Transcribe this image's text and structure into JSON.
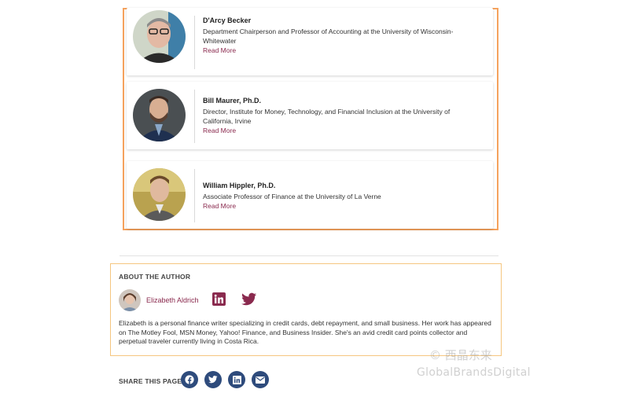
{
  "experts": [
    {
      "name": "D'Arcy Becker",
      "title_line1": "Department Chairperson and Professor of Accounting at the University of Wisconsin-",
      "title_line2": "Whitewater",
      "read_more": "Read More"
    },
    {
      "name": "Bill Maurer, Ph.D.",
      "title_line1": "Director, Institute for Money, Technology, and Financial Inclusion at the University of",
      "title_line2": "California, Irvine",
      "read_more": "Read More"
    },
    {
      "name": "William Hippler, Ph.D.",
      "title_line1": "Associate Professor of Finance at the University of La Verne",
      "title_line2": "",
      "read_more": "Read More"
    }
  ],
  "author": {
    "heading": "ABOUT THE AUTHOR",
    "name": "Elizabeth Aldrich",
    "bio": "Elizabeth is a personal finance writer specializing in credit cards, debt repayment, and small business. Her work has appeared on The Motley Fool, MSN Money, Yahoo! Finance, and Business Insider. She's an avid credit card points collector and perpetual traveler currently living in Costa Rica.",
    "social_icons": [
      "linkedin-icon",
      "twitter-icon"
    ]
  },
  "share": {
    "label": "SHARE THIS PAGE",
    "icons": [
      "facebook-icon",
      "twitter-icon",
      "linkedin-icon",
      "email-icon"
    ]
  },
  "watermark": {
    "line1": "© 西晶东来",
    "line2": "GlobalBrandsDigital"
  },
  "colors": {
    "accent": "#8a2a4e",
    "highlight_orange": "#f5a25d",
    "highlight_yellow": "#f5c680",
    "share_button": "#2e4b7c"
  }
}
